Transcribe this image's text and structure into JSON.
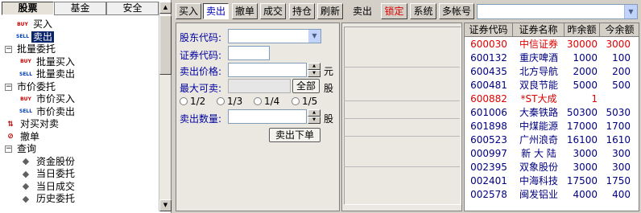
{
  "left_tabs": [
    "股票",
    "基金",
    "安全"
  ],
  "tree": [
    {
      "label": "买入",
      "icon": "buy-icon",
      "icon_text": "BUY"
    },
    {
      "label": "卖出",
      "icon": "sell-icon",
      "icon_text": "SELL",
      "selected": true
    },
    {
      "label": "批量委托",
      "icon": "expander-icon",
      "icon_text": "−"
    },
    {
      "label": "批量买入",
      "icon": "buy-icon",
      "icon_text": "BUY"
    },
    {
      "label": "批量卖出",
      "icon": "sell-icon",
      "icon_text": "SELL"
    },
    {
      "label": "市价委托",
      "icon": "expander-icon",
      "icon_text": "−"
    },
    {
      "label": "市价买入",
      "icon": "buy-icon",
      "icon_text": "BUY"
    },
    {
      "label": "市价卖出",
      "icon": "sell-icon",
      "icon_text": "SELL"
    },
    {
      "label": "对买对卖",
      "icon": "swap-icon",
      "icon_text": "⇅"
    },
    {
      "label": "撤单",
      "icon": "cancel-icon",
      "icon_text": "⊘"
    },
    {
      "label": "查询",
      "icon": "expander-icon",
      "icon_text": "−"
    },
    {
      "label": "资金股份",
      "icon": "query-icon",
      "icon_text": "◆"
    },
    {
      "label": "当日委托",
      "icon": "query-icon",
      "icon_text": "◆"
    },
    {
      "label": "当日成交",
      "icon": "query-icon",
      "icon_text": "◆"
    },
    {
      "label": "历史委托",
      "icon": "query-icon",
      "icon_text": "◆"
    }
  ],
  "toolbar": {
    "buy": "买入",
    "sell": "卖出",
    "cancel": "撤单",
    "deal": "成交",
    "position": "持仓",
    "refresh": "刷新",
    "mode": "卖出",
    "lock": "锁定",
    "system": "系统",
    "multi_account": "多帐号",
    "account_value": ""
  },
  "form": {
    "shareholder_code_label": "股东代码:",
    "shareholder_code_value": "",
    "security_code_label": "证券代码:",
    "security_code_value": "",
    "sell_price_label": "卖出价格:",
    "sell_price_value": "",
    "price_unit": "元",
    "max_sellable_label": "最大可卖:",
    "max_sellable_value": "",
    "all_button": "全部",
    "share_unit": "股",
    "fractions": [
      "1/2",
      "1/3",
      "1/4",
      "1/5"
    ],
    "sell_qty_label": "卖出数量:",
    "sell_qty_value": "",
    "qty_unit": "股",
    "submit": "卖出下单"
  },
  "table": {
    "headers": [
      "证券代码",
      "证券名称",
      "昨余额",
      "今余额"
    ],
    "rows": [
      {
        "code": "600030",
        "name": "中信证券",
        "prev": "30000",
        "today": "3000",
        "color": "red"
      },
      {
        "code": "600132",
        "name": "重庆啤酒",
        "prev": "1000",
        "today": "100",
        "color": "blue"
      },
      {
        "code": "600435",
        "name": "北方导航",
        "prev": "2000",
        "today": "200",
        "color": "blue"
      },
      {
        "code": "600481",
        "name": "双良节能",
        "prev": "5000",
        "today": "500",
        "color": "blue"
      },
      {
        "code": "600882",
        "name": "*ST大成",
        "prev": "1",
        "today": "",
        "color": "red"
      },
      {
        "code": "601006",
        "name": "大秦铁路",
        "prev": "50300",
        "today": "5030",
        "color": "blue"
      },
      {
        "code": "601898",
        "name": "中煤能源",
        "prev": "17000",
        "today": "1700",
        "color": "blue"
      },
      {
        "code": "600523",
        "name": "广州浪奇",
        "prev": "16100",
        "today": "1610",
        "color": "blue"
      },
      {
        "code": "000997",
        "name": "新 大 陆",
        "prev": "3000",
        "today": "300",
        "color": "blue"
      },
      {
        "code": "002395",
        "name": "双象股份",
        "prev": "3000",
        "today": "300",
        "color": "blue"
      },
      {
        "code": "002401",
        "name": "中海科技",
        "prev": "17500",
        "today": "1750",
        "color": "blue"
      },
      {
        "code": "002578",
        "name": "闽发铝业",
        "prev": "4000",
        "today": "400",
        "color": "blue"
      }
    ]
  },
  "colors": {
    "accent": "#0000c0",
    "gain": "#e00000",
    "selection": "#0a246a"
  }
}
